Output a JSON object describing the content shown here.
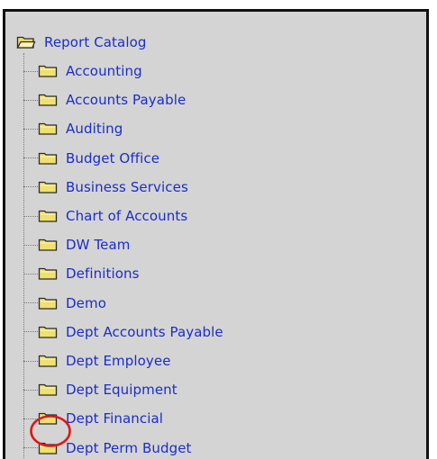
{
  "tree": {
    "root": {
      "label": "Report Catalog",
      "icon": "folder-open-icon"
    },
    "items": [
      {
        "label": "Accounting",
        "icon": "folder-icon"
      },
      {
        "label": "Accounts Payable",
        "icon": "folder-icon"
      },
      {
        "label": "Auditing",
        "icon": "folder-icon"
      },
      {
        "label": "Budget Office",
        "icon": "folder-icon"
      },
      {
        "label": "Business Services",
        "icon": "folder-icon"
      },
      {
        "label": "Chart of Accounts",
        "icon": "folder-icon"
      },
      {
        "label": "DW Team",
        "icon": "folder-icon"
      },
      {
        "label": "Definitions",
        "icon": "folder-icon"
      },
      {
        "label": "Demo",
        "icon": "folder-icon"
      },
      {
        "label": "Dept Accounts Payable",
        "icon": "folder-icon"
      },
      {
        "label": "Dept Employee",
        "icon": "folder-icon"
      },
      {
        "label": "Dept Equipment",
        "icon": "folder-icon"
      },
      {
        "label": "Dept Financial",
        "icon": "folder-icon"
      },
      {
        "label": "Dept Perm Budget",
        "icon": "folder-icon"
      }
    ]
  },
  "annotation": {
    "shape": "circle",
    "color": "#e01818",
    "target": "Dept Financial"
  },
  "colors": {
    "link": "#1b2dc9",
    "panel_background": "#d4d4d4",
    "folder_fill": "#efe070",
    "folder_outline": "#2a2a2a"
  }
}
